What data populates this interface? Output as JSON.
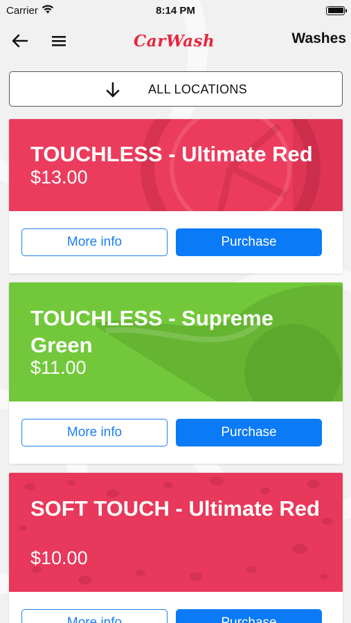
{
  "status_bar": {
    "carrier": "Carrier",
    "time": "8:14 PM"
  },
  "nav": {
    "logo_text": "CarWash",
    "title": "Washes",
    "back_icon": "arrow-left-icon",
    "menu_icon": "hamburger-menu-icon"
  },
  "location_selector": {
    "label": "ALL LOCATIONS",
    "icon": "arrow-down-icon"
  },
  "washes": [
    {
      "title": "TOUCHLESS - Ultimate Red",
      "price": "$13.00",
      "color": "#ec3c5d",
      "more_info_label": "More info",
      "purchase_label": "Purchase"
    },
    {
      "title": "TOUCHLESS - Supreme Green",
      "price": "$11.00",
      "color": "#72c83a",
      "more_info_label": "More info",
      "purchase_label": "Purchase"
    },
    {
      "title": "SOFT TOUCH - Ultimate Red",
      "price": "$10.00",
      "color": "#e8385b",
      "more_info_label": "More info",
      "purchase_label": "Purchase"
    }
  ],
  "colors": {
    "accent_blue": "#0a7af7",
    "brand_red": "#e8253d"
  }
}
